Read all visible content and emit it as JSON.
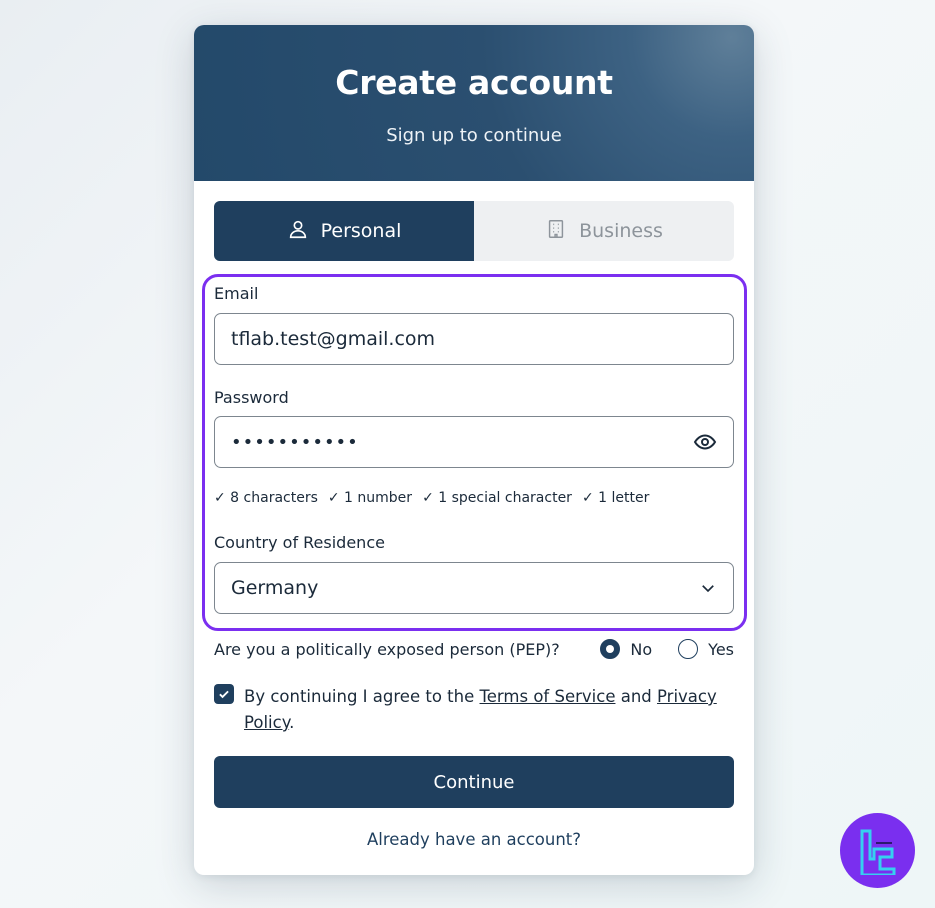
{
  "header": {
    "title": "Create account",
    "subtitle": "Sign up to continue"
  },
  "tabs": [
    {
      "label": "Personal",
      "icon": "user-icon",
      "active": true
    },
    {
      "label": "Business",
      "icon": "building-icon",
      "active": false
    }
  ],
  "form": {
    "email_label": "Email",
    "email_value": "tflab.test@gmail.com",
    "password_label": "Password",
    "password_value": "•••••••••••",
    "password_requirements": [
      "✓ 8 characters",
      "✓ 1 number",
      "✓ 1 special character",
      "✓ 1 letter"
    ],
    "country_label": "Country of Residence",
    "country_value": "Germany"
  },
  "pep": {
    "question": "Are you a politically exposed person (PEP)?",
    "options": [
      "No",
      "Yes"
    ],
    "selected": "No"
  },
  "agreement": {
    "prefix": "By continuing I agree to the",
    "terms_link": "Terms of Service",
    "and": "and",
    "privacy_link": "Privacy Policy",
    "suffix": ".",
    "checked": true
  },
  "actions": {
    "continue_label": "Continue",
    "signin_link": "Already have an account?"
  },
  "colors": {
    "primary": "#1f3f5e",
    "highlight": "#7b2ff0",
    "logo_bg": "#7a2fef",
    "logo_accent": "#35d0f0"
  }
}
